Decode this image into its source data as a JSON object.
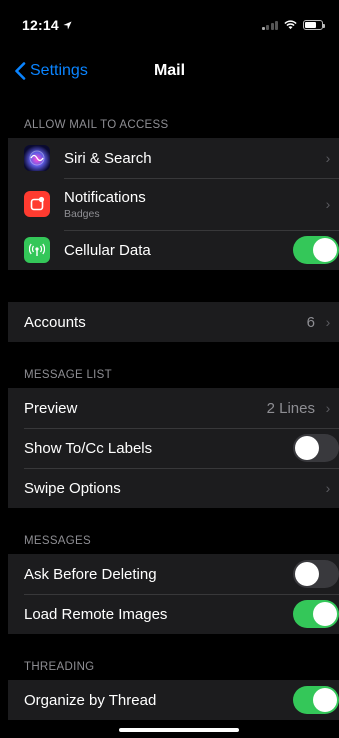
{
  "status_bar": {
    "time": "12:14",
    "location_arrow": "location-arrow-icon"
  },
  "nav": {
    "back_label": "Settings",
    "title": "Mail"
  },
  "sections": {
    "allow_access": {
      "header": "ALLOW MAIL TO ACCESS",
      "siri": {
        "label": "Siri & Search"
      },
      "notifications": {
        "label": "Notifications",
        "sublabel": "Badges"
      },
      "cellular": {
        "label": "Cellular Data",
        "enabled": true
      }
    },
    "accounts": {
      "label": "Accounts",
      "value": "6"
    },
    "message_list": {
      "header": "MESSAGE LIST",
      "preview": {
        "label": "Preview",
        "value": "2 Lines"
      },
      "show_tocc": {
        "label": "Show To/Cc Labels",
        "enabled": false
      },
      "swipe": {
        "label": "Swipe Options"
      }
    },
    "messages": {
      "header": "MESSAGES",
      "ask_delete": {
        "label": "Ask Before Deleting",
        "enabled": false
      },
      "load_images": {
        "label": "Load Remote Images",
        "enabled": true
      }
    },
    "threading": {
      "header": "THREADING",
      "organize": {
        "label": "Organize by Thread",
        "enabled": true
      }
    }
  },
  "colors": {
    "accent": "#0a84ff",
    "toggle_on": "#34c759",
    "notifications_icon": "#ff3b30",
    "cellular_icon": "#34c759"
  }
}
